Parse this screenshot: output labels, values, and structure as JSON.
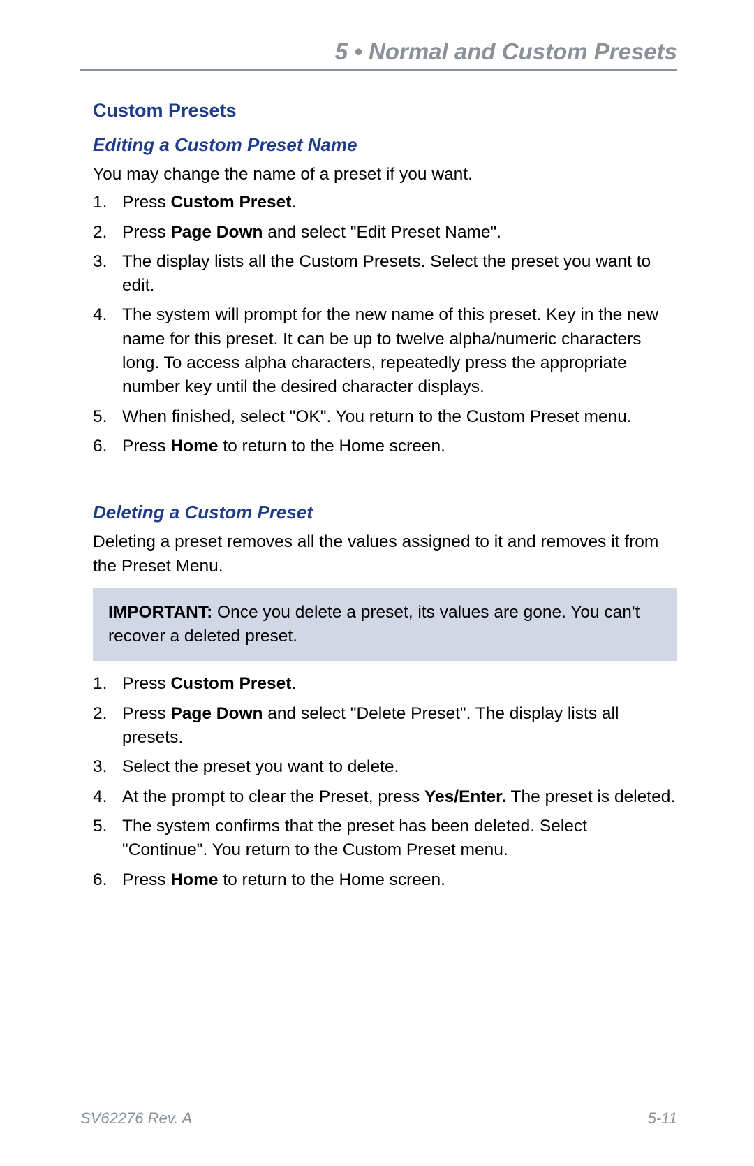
{
  "chapter": {
    "header": "5 • Normal and Custom Presets"
  },
  "section": {
    "title": "Custom Presets"
  },
  "edit": {
    "title": "Editing a Custom Preset Name",
    "intro": "You may change the name of a preset if you want.",
    "steps": {
      "s1a": "Press ",
      "s1b": "Custom Preset",
      "s1c": ".",
      "s2a": "Press ",
      "s2b": "Page Down",
      "s2c": " and select \"Edit Preset Name\".",
      "s3": "The display lists all the Custom Presets. Select the preset you want to edit.",
      "s4": "The system will prompt for the new name of this preset. Key in the new name for this preset. It can be up to twelve alpha/numeric characters long. To access alpha characters, repeatedly press the appropriate number key until the desired character displays.",
      "s5": "When finished, select \"OK\". You return to the Custom Preset menu.",
      "s6a": "Press ",
      "s6b": "Home",
      "s6c": " to return to the Home screen."
    }
  },
  "delete": {
    "title": "Deleting a Custom Preset",
    "intro": "Deleting a preset removes all the values assigned to it and removes it from the Preset Menu.",
    "notice_label": "IMPORTANT:",
    "notice_body": " Once you delete a preset, its values are gone. You can't recover a deleted preset.",
    "steps": {
      "s1a": "Press ",
      "s1b": "Custom Preset",
      "s1c": ".",
      "s2a": "Press ",
      "s2b": "Page Down",
      "s2c": " and select \"Delete Preset\". The display lists all presets.",
      "s3": "Select the preset you want to delete.",
      "s4a": "At the prompt to clear the Preset, press ",
      "s4b": "Yes/Enter.",
      "s4c": " The preset is deleted.",
      "s5": "The system confirms that the preset has been deleted. Select \"Continue\". You return to the Custom Preset menu.",
      "s6a": "Press ",
      "s6b": "Home",
      "s6c": " to return to the Home screen."
    }
  },
  "footer": {
    "doc_ref": "SV62276 Rev. A",
    "page_num": "5-11"
  }
}
